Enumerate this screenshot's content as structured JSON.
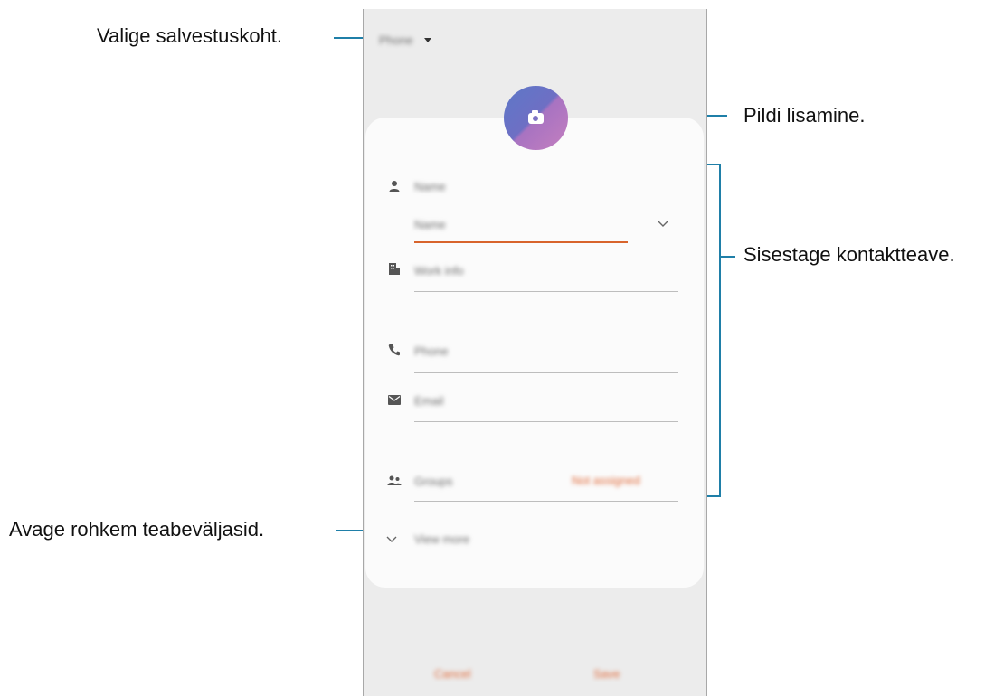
{
  "annotations": {
    "storage_location": "Valige salvestuskoht.",
    "add_picture": "Pildi lisamine.",
    "enter_contact_info": "Sisestage kontaktteave.",
    "open_more_fields": "Avage rohkem teabeväljasid."
  },
  "header": {
    "storage_value": "Phone"
  },
  "form": {
    "name_placeholder": "Name",
    "name_sub_placeholder": "Name",
    "work_info_placeholder": "Work info",
    "phone_placeholder": "Phone",
    "email_placeholder": "Email",
    "groups_label": "Groups",
    "groups_value": "Not assigned",
    "view_more_label": "View more"
  },
  "footer": {
    "cancel_label": "Cancel",
    "save_label": "Save"
  },
  "colors": {
    "accent": "#d8642c",
    "callout": "#1f7fa8",
    "avatar_start": "#5d78c8",
    "avatar_end": "#c47fc0"
  }
}
